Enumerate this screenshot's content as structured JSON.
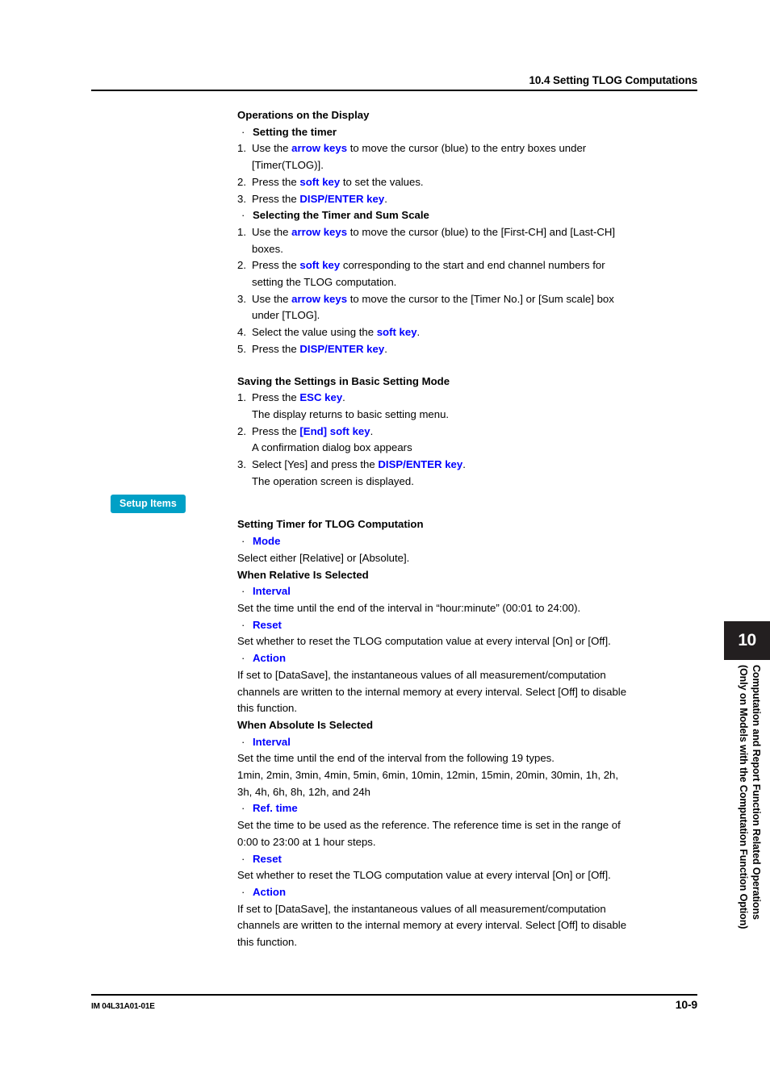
{
  "header": {
    "title": "10.4  Setting TLOG Computations"
  },
  "footer": {
    "doc_code": "IM 04L31A01-01E",
    "page_number": "10-9"
  },
  "side_tab": {
    "chapter_number": "10",
    "line1": "Computation  and Report Function Related Operations",
    "line2": "(Only on Models with the Computation Function Option)"
  },
  "badge": {
    "setup_items": "Setup Items"
  },
  "colors": {
    "link_blue": "#0000ff",
    "badge_cyan": "#00a0c6",
    "tab_black": "#231f20"
  },
  "bullets": {
    "dot": "·"
  },
  "sections": {
    "operations": {
      "heading": "Operations on the Display",
      "sub1": {
        "title": "Setting the timer",
        "steps": [
          {
            "num": "1.",
            "parts": [
              {
                "t": "Use the ",
                "b": false
              },
              {
                "t": "arrow keys",
                "b": true
              },
              {
                "t": " to move the cursor (blue) to the entry boxes under",
                "b": false
              }
            ],
            "cont": "[Timer(TLOG)]."
          },
          {
            "num": "2.",
            "parts": [
              {
                "t": "Press the ",
                "b": false
              },
              {
                "t": "soft key",
                "b": true
              },
              {
                "t": " to set the values.",
                "b": false
              }
            ],
            "cont": ""
          },
          {
            "num": "3.",
            "parts": [
              {
                "t": "Press the ",
                "b": false
              },
              {
                "t": "DISP/ENTER key",
                "b": true
              },
              {
                "t": ".",
                "b": false
              }
            ],
            "cont": ""
          }
        ]
      },
      "sub2": {
        "title": "Selecting the Timer and Sum Scale",
        "steps": [
          {
            "num": "1.",
            "parts": [
              {
                "t": "Use the ",
                "b": false
              },
              {
                "t": "arrow keys",
                "b": true
              },
              {
                "t": " to move the cursor (blue) to the [First-CH] and [Last-CH]",
                "b": false
              }
            ],
            "cont": "boxes."
          },
          {
            "num": "2.",
            "parts": [
              {
                "t": "Press the ",
                "b": false
              },
              {
                "t": "soft key",
                "b": true
              },
              {
                "t": " corresponding to the start and end channel numbers for",
                "b": false
              }
            ],
            "cont": "setting the TLOG computation."
          },
          {
            "num": "3.",
            "parts": [
              {
                "t": "Use the ",
                "b": false
              },
              {
                "t": "arrow keys",
                "b": true
              },
              {
                "t": " to move the cursor to the [Timer No.] or [Sum scale] box",
                "b": false
              }
            ],
            "cont": "under [TLOG]."
          },
          {
            "num": "4.",
            "parts": [
              {
                "t": "Select the value using the ",
                "b": false
              },
              {
                "t": "soft key",
                "b": true
              },
              {
                "t": ".",
                "b": false
              }
            ],
            "cont": ""
          },
          {
            "num": "5.",
            "parts": [
              {
                "t": "Press the ",
                "b": false
              },
              {
                "t": "DISP/ENTER key",
                "b": true
              },
              {
                "t": ".",
                "b": false
              }
            ],
            "cont": ""
          }
        ]
      }
    },
    "saving": {
      "heading": "Saving the Settings in Basic Setting Mode",
      "steps": [
        {
          "num": "1.",
          "parts": [
            {
              "t": "Press the ",
              "b": false
            },
            {
              "t": "ESC key",
              "b": true
            },
            {
              "t": ".",
              "b": false
            }
          ],
          "cont": "The display returns to basic setting menu."
        },
        {
          "num": "2.",
          "parts": [
            {
              "t": "Press the ",
              "b": false
            },
            {
              "t": "[End] soft key",
              "b": true
            },
            {
              "t": ".",
              "b": false
            }
          ],
          "cont": "A confirmation dialog box appears"
        },
        {
          "num": "3.",
          "parts": [
            {
              "t": "Select [Yes] and press the ",
              "b": false
            },
            {
              "t": "DISP/ENTER key",
              "b": true
            },
            {
              "t": ".",
              "b": false
            }
          ],
          "cont": "The operation screen is displayed."
        }
      ]
    },
    "timer_setup": {
      "heading": "Setting Timer for TLOG Computation",
      "mode_label": "Mode",
      "mode_desc": "Select either [Relative] or [Absolute].",
      "relative_heading": "When Relative Is Selected",
      "relative_items": [
        {
          "label": "Interval",
          "lines": [
            "Set the time until the end of the interval in “hour:minute” (00:01 to 24:00)."
          ]
        },
        {
          "label": "Reset",
          "lines": [
            "Set whether to reset the TLOG computation value at every interval [On] or [Off]."
          ]
        },
        {
          "label": "Action",
          "lines": [
            "If set to [DataSave], the instantaneous values of all measurement/computation",
            "channels are written to the internal memory at every interval.  Select [Off] to disable",
            "this function."
          ]
        }
      ],
      "absolute_heading": "When Absolute Is Selected",
      "absolute_items": [
        {
          "label": "Interval",
          "lines": [
            "Set the time until the end of the interval from the following 19 types.",
            "1min, 2min, 3min, 4min, 5min, 6min, 10min, 12min, 15min, 20min, 30min, 1h, 2h,",
            "3h, 4h, 6h, 8h, 12h, and 24h"
          ]
        },
        {
          "label": "Ref. time",
          "lines": [
            "Set the time to be used as the reference.  The reference time is set in the range of",
            "0:00 to 23:00 at 1 hour steps."
          ]
        },
        {
          "label": "Reset",
          "lines": [
            "Set whether to reset the TLOG computation value at every interval [On] or [Off]."
          ]
        },
        {
          "label": "Action",
          "lines": [
            "If set to [DataSave], the instantaneous values of all measurement/computation",
            "channels are written to the internal memory at every interval.  Select [Off] to disable",
            "this function."
          ]
        }
      ]
    }
  }
}
